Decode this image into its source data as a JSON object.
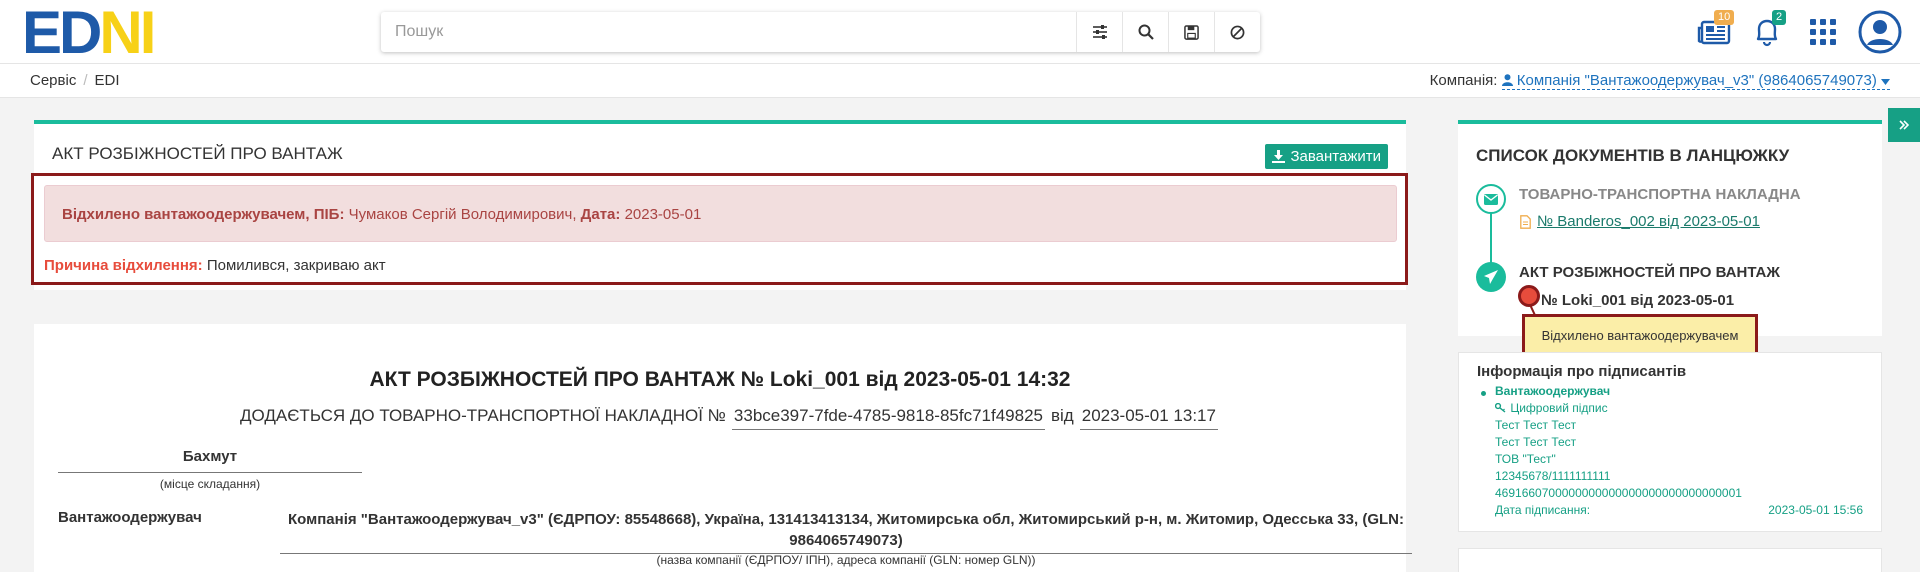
{
  "header": {
    "logo_left": "ED",
    "logo_right": "NI",
    "search_placeholder": "Пошук",
    "search_buttons": [
      "sliders-icon",
      "search-icon",
      "save-icon",
      "clear-icon"
    ],
    "news_badge": "10",
    "notifications_badge": "2"
  },
  "breadcrumb": {
    "items": [
      "Сервіс",
      "EDI"
    ]
  },
  "company": {
    "label": "Компанія:",
    "value": "Компанія \"Вантажоодержувач_v3\" (9864065749073)"
  },
  "document_panel": {
    "title": "АКТ РОЗБІЖНОСТЕЙ ПРО ВАНТАЖ",
    "download_label": "Завантажити",
    "alert": {
      "status_label": "Відхилено вантажоодержувачем, ПІБ:",
      "person": "Чумаков Сергій Володимирович,",
      "date_label": "Дата:",
      "date": "2023-05-01"
    },
    "reason": {
      "label": "Причина відхилення:",
      "value": "Помилився, закриваю акт"
    }
  },
  "document_body": {
    "title": "АКТ РОЗБІЖНОСТЕЙ ПРО ВАНТАЖ № Loki_001 від 2023-05-01 14:32",
    "subline_prefix": "ДОДАЄТЬСЯ ДО ТОВАРНО-ТРАНСПОРТНОЇ НАКЛАДНОЇ №",
    "waybill_id": "33bce397-7fde-4785-9818-85fc71f49825",
    "subline_mid": "від",
    "waybill_date": "2023-05-01 13:17",
    "place": "Бахмут",
    "place_caption": "(місце складання)",
    "recipient_label": "Вантажоодержувач",
    "recipient_value": "Компанія \"Вантажоодержувач_v3\" (ЄДРПОУ: 85548668), Україна, 131413413134, Житомирська обл, Житомирський р-н, м. Житомир, Одесська 33, (GLN: 9864065749073)",
    "recipient_caption": "(назва компанії (ЄДРПОУ/ ІПН), адреса компанії (GLN: номер GLN))"
  },
  "chain": {
    "title": "СПИСОК ДОКУМЕНТІВ В ЛАНЦЮЖКУ",
    "items": [
      {
        "title": "ТОВАРНО-ТРАНСПОРТНА НАКЛАДНА",
        "link": "№ Banderos_002 від 2023-05-01",
        "icon": "envelope-icon"
      },
      {
        "title": "АКТ РОЗБІЖНОСТЕЙ ПРО ВАНТАЖ",
        "number": "№ Loki_001 від 2023-05-01",
        "icon": "paper-plane-icon"
      }
    ],
    "tooltip": "Відхилено вантажоодержувачем"
  },
  "signers": {
    "title": "Інформація про підписантів",
    "role": "Вантажоодержувач",
    "signature_label": "Цифровий підпис",
    "lines": [
      "Тест Тест Тест",
      "Тест Тест Тест",
      "ТОВ \"Тест\"",
      "12345678/1111111111",
      "4691660700000000000000000000000000001"
    ],
    "date_label": "Дата підписання:",
    "date": "2023-05-01 15:56"
  },
  "colors": {
    "accent": "#1abc9c",
    "button": "#16a085",
    "link": "#1e73be",
    "alert_bg": "#f2dede",
    "alert_text": "#a94442",
    "highlight_frame": "#8b1a1a"
  }
}
